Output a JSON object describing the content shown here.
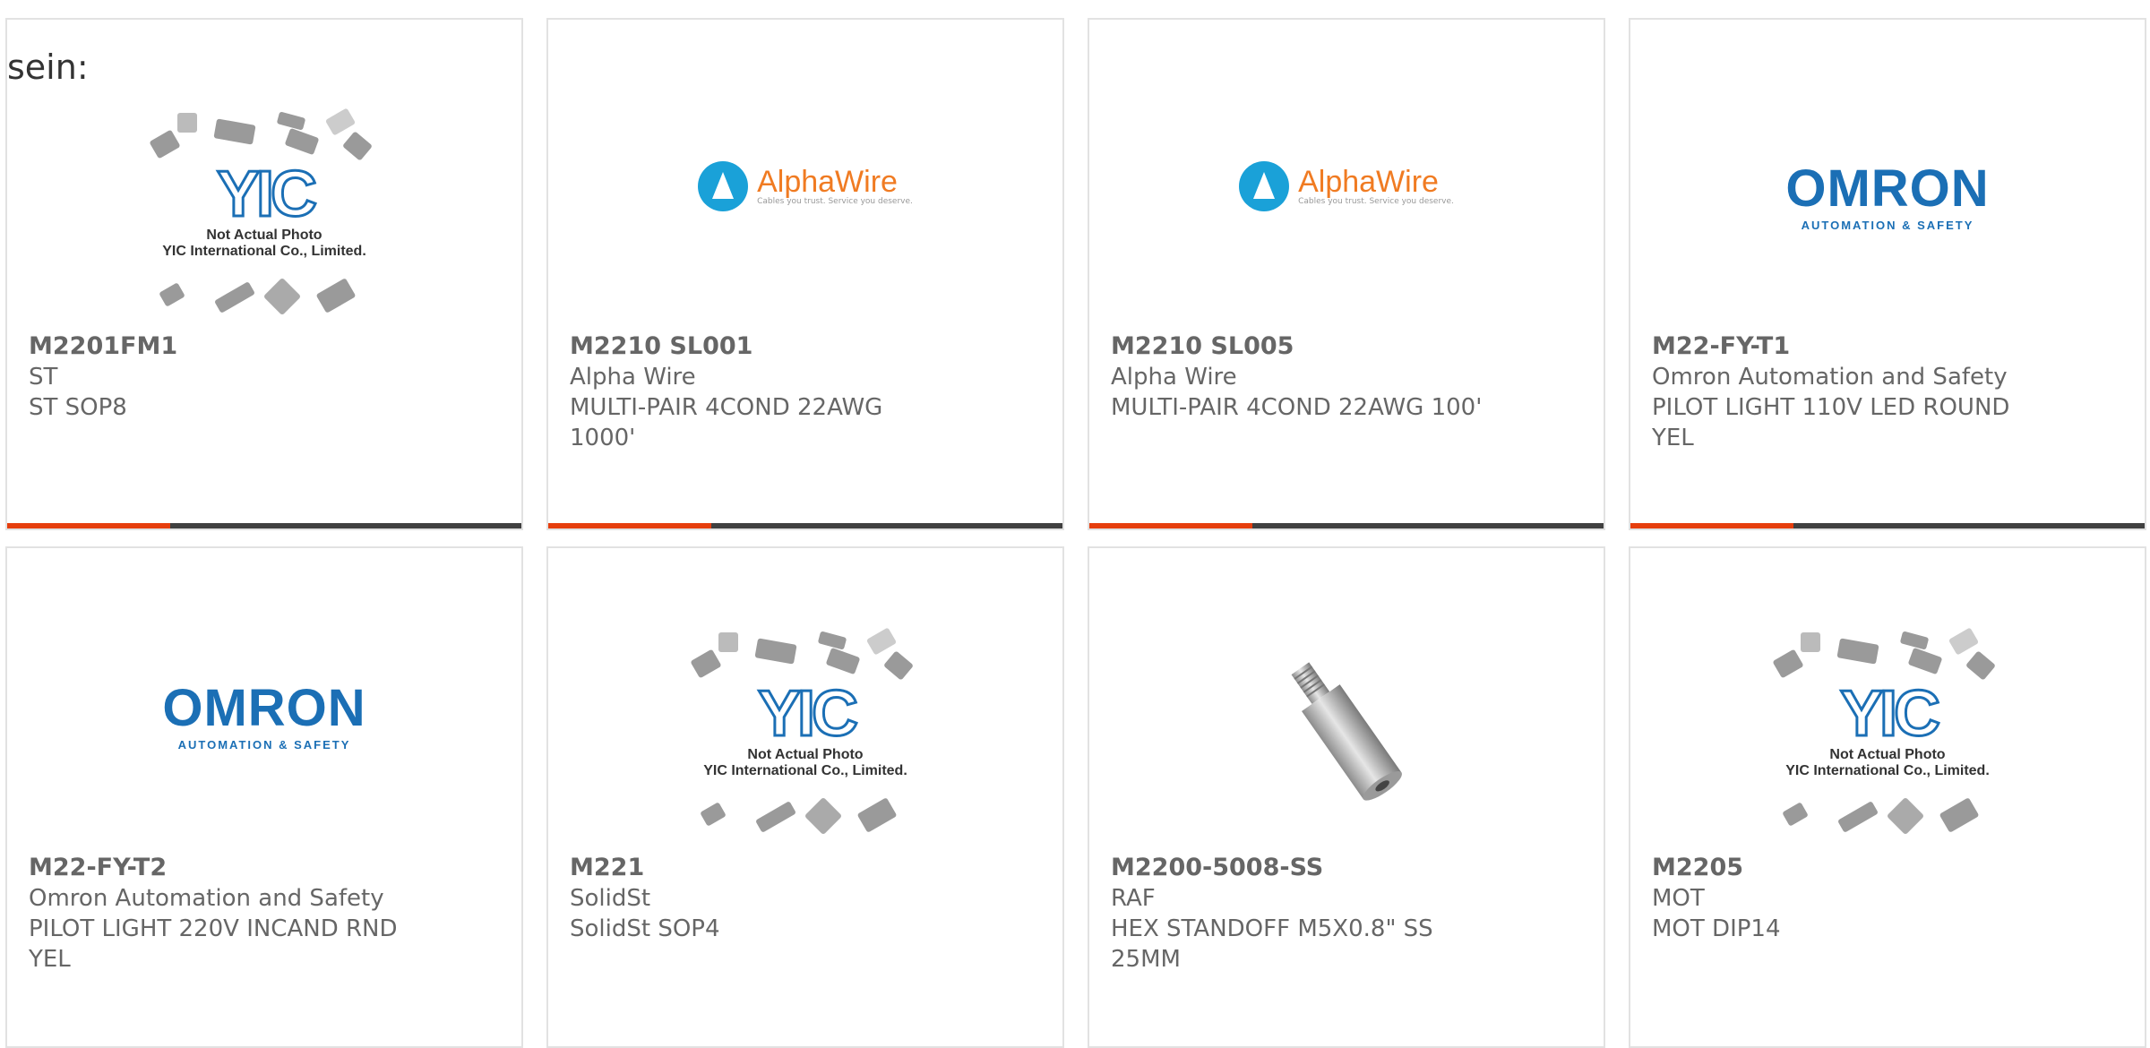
{
  "lead_text": "sein:",
  "colors": {
    "accent": "#e63e0d",
    "bar": "#404040",
    "omron_blue": "#1b6fb5",
    "alpha_orange": "#f07b22"
  },
  "yic_caption": {
    "line1": "Not Actual Photo",
    "line2": "YIC International Co., Limited."
  },
  "yic_letters": "YIC",
  "alpha_logo": {
    "name": "AlphaWire",
    "tagline": "Cables you trust. Service you deserve."
  },
  "omron_logo": {
    "name": "OMRON",
    "sub": "AUTOMATION & SAFETY"
  },
  "cards": [
    {
      "part": "M2201FM1",
      "manufacturer": "ST",
      "description": "ST SOP8",
      "image": "yic-placeholder"
    },
    {
      "part": "M2210 SL001",
      "manufacturer": "Alpha Wire",
      "description": "MULTI-PAIR 4COND 22AWG 1000'",
      "image": "alphawire-logo"
    },
    {
      "part": "M2210 SL005",
      "manufacturer": "Alpha Wire",
      "description": "MULTI-PAIR 4COND 22AWG 100'",
      "image": "alphawire-logo"
    },
    {
      "part": "M22-FY-T1",
      "manufacturer": "Omron Automation and Safety",
      "description": "PILOT LIGHT 110V LED ROUND YEL",
      "image": "omron-logo"
    },
    {
      "part": "M22-FY-T2",
      "manufacturer": "Omron Automation and Safety",
      "description": "PILOT LIGHT 220V INCAND RND YEL",
      "image": "omron-logo"
    },
    {
      "part": "M221",
      "manufacturer": "SolidSt",
      "description": "SolidSt SOP4",
      "image": "yic-placeholder"
    },
    {
      "part": "M2200-5008-SS",
      "manufacturer": "RAF",
      "description": "HEX STANDOFF M5X0.8\" SS 25MM",
      "image": "hex-standoff-photo"
    },
    {
      "part": "M2205",
      "manufacturer": "MOT",
      "description": "MOT DIP14",
      "image": "yic-placeholder"
    }
  ]
}
